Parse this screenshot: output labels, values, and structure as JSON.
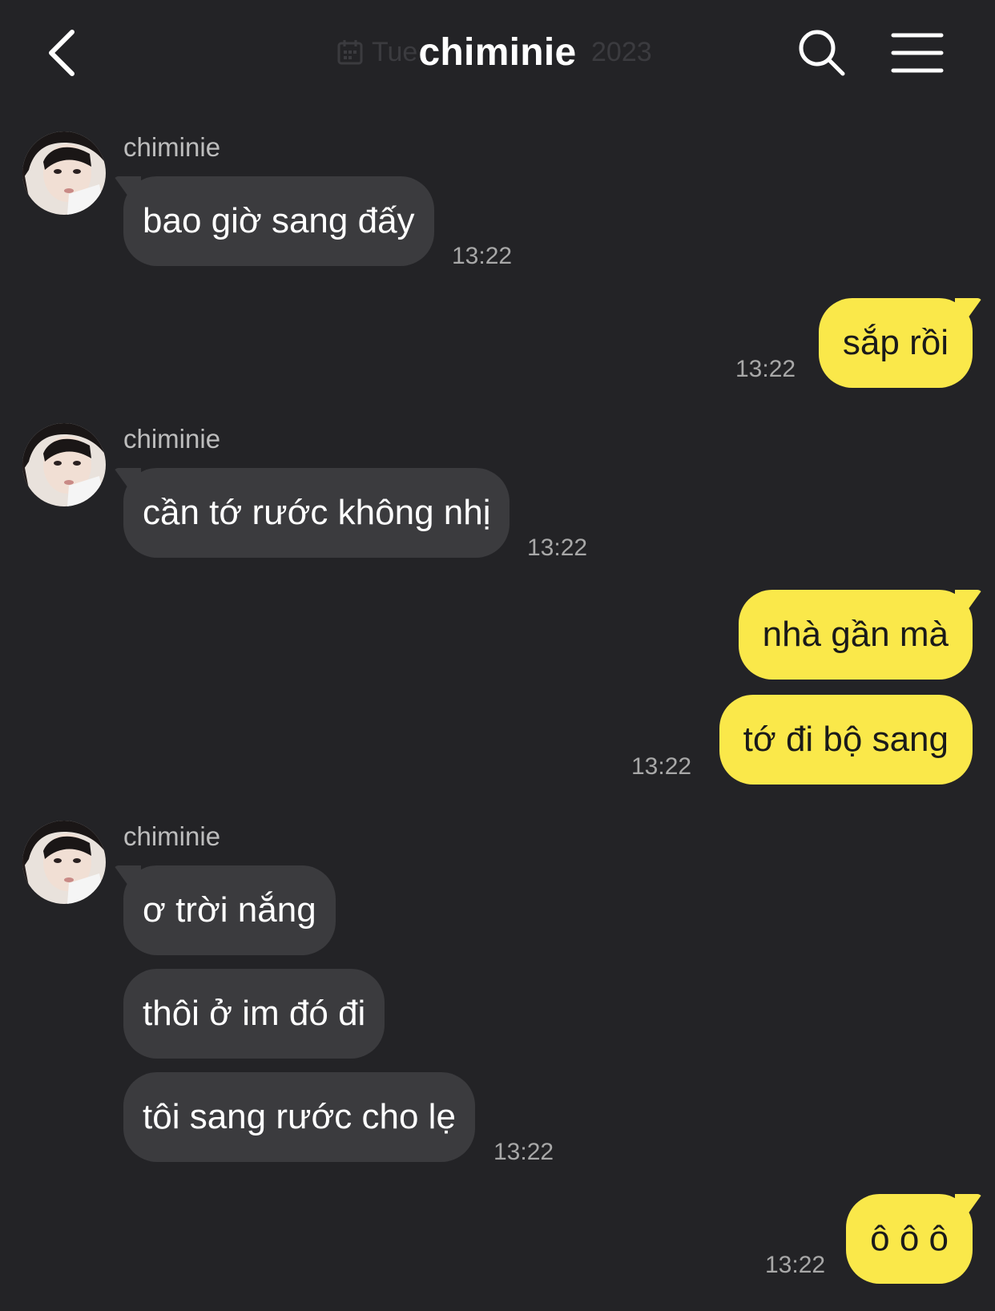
{
  "header": {
    "title": "chiminie",
    "date_day": "Tue",
    "date_year": "2023"
  },
  "messages": [
    {
      "sender": "chiminie",
      "text": "bao giờ sang đấy",
      "time": "13:22"
    },
    {
      "text": "sắp rồi",
      "time": "13:22"
    },
    {
      "sender": "chiminie",
      "text": "cần tớ rước không nhị",
      "time": "13:22"
    },
    {
      "text": "nhà gần mà"
    },
    {
      "text": "tớ đi bộ sang",
      "time": "13:22"
    },
    {
      "sender": "chiminie",
      "text": "ơ trời nắng"
    },
    {
      "text": "thôi ở im đó đi"
    },
    {
      "text": "tôi sang rước cho lẹ",
      "time": "13:22"
    },
    {
      "text": "ô ô ô",
      "time": "13:22"
    }
  ],
  "colors": {
    "background": "#232326",
    "incoming_bubble": "#3b3b3e",
    "outgoing_bubble": "#fae84a"
  }
}
